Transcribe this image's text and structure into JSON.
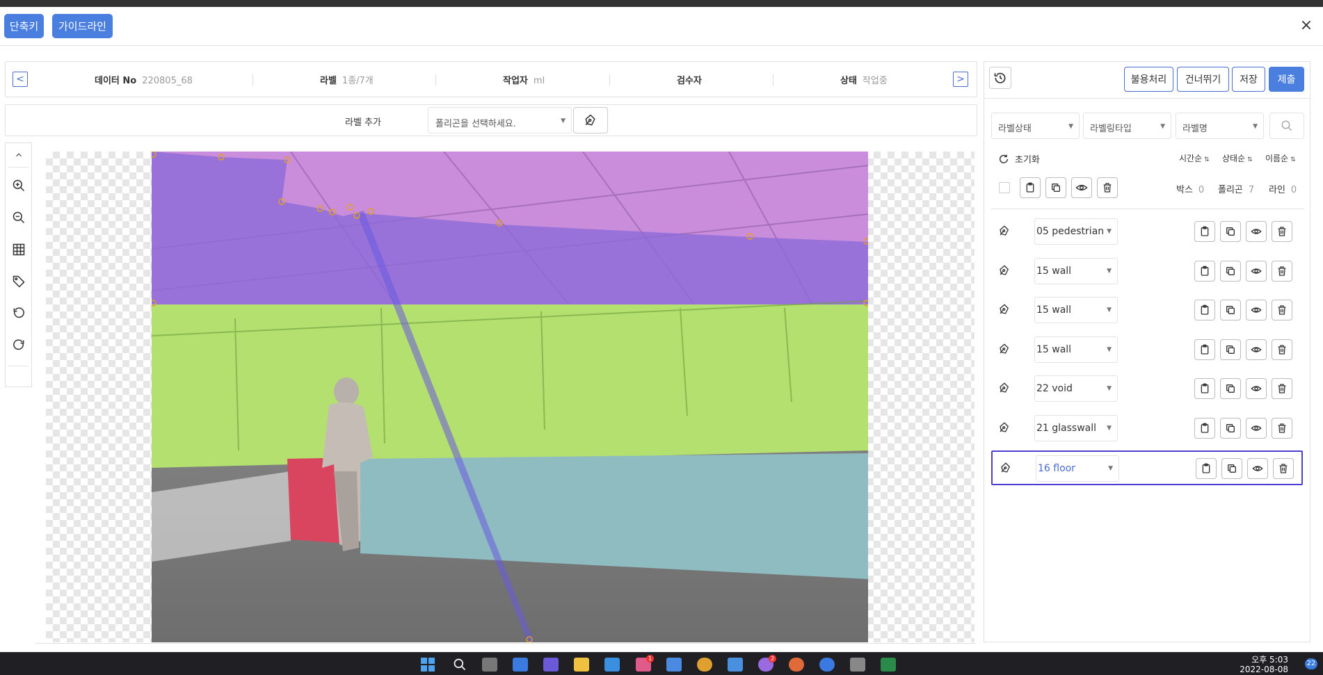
{
  "header": {
    "shortcut_label": "단축키",
    "guideline_label": "가이드라인",
    "close_symbol": "×"
  },
  "info": {
    "prev_symbol": "<",
    "next_symbol": ">",
    "data_no_label": "데이터 No",
    "data_no_value": "220805_68",
    "label_label": "라벨",
    "label_value": "1종/7개",
    "worker_label": "작업자",
    "worker_value": "ml",
    "reviewer_label": "검수자",
    "reviewer_value": "",
    "status_label": "상태",
    "status_value": "작업중"
  },
  "toolbar": {
    "add_label": "라벨 추가",
    "select_placeholder": "폴리곤을 선택하세요.",
    "pen_icon": "pen-tool-icon"
  },
  "left_tools": [
    "chevron-up-icon",
    "zoom-in-icon",
    "zoom-out-icon",
    "grid-icon",
    "tag-icon",
    "undo-icon",
    "redo-icon"
  ],
  "actions": {
    "history_icon": "history-icon",
    "unusable": "불용처리",
    "skip": "건너뛰기",
    "save": "저장",
    "submit": "제출"
  },
  "filters": {
    "status": "라벨상태",
    "type": "라벨링타입",
    "name": "라벨명",
    "search_icon": "search-icon"
  },
  "sort": {
    "reset": "초기화",
    "time": "시간순",
    "state": "상태순",
    "name": "이름순"
  },
  "counts": {
    "box_label": "박스",
    "box_value": "0",
    "polygon_label": "폴리곤",
    "polygon_value": "7",
    "line_label": "라인",
    "line_value": "0"
  },
  "labels": [
    {
      "name": "05 pedestrian",
      "selected": false
    },
    {
      "name": "15 wall",
      "selected": false
    },
    {
      "name": "15 wall",
      "selected": false
    },
    {
      "name": "15 wall",
      "selected": false
    },
    {
      "name": "22 void",
      "selected": false
    },
    {
      "name": "21 glasswall",
      "selected": false
    },
    {
      "name": "16 floor",
      "selected": true
    }
  ],
  "colors": {
    "accent": "#4a7fe0",
    "ceiling": "#c98ddb",
    "wall_purple": "#8a6ad8",
    "wall_green": "#b3e06e",
    "floor_teal": "#8fbcc0",
    "red_box": "#d9455f"
  },
  "taskbar": {
    "time": "오후 5:03",
    "date": "2022-08-08",
    "notifications": "22",
    "badge1": "1",
    "badge2": "2"
  }
}
